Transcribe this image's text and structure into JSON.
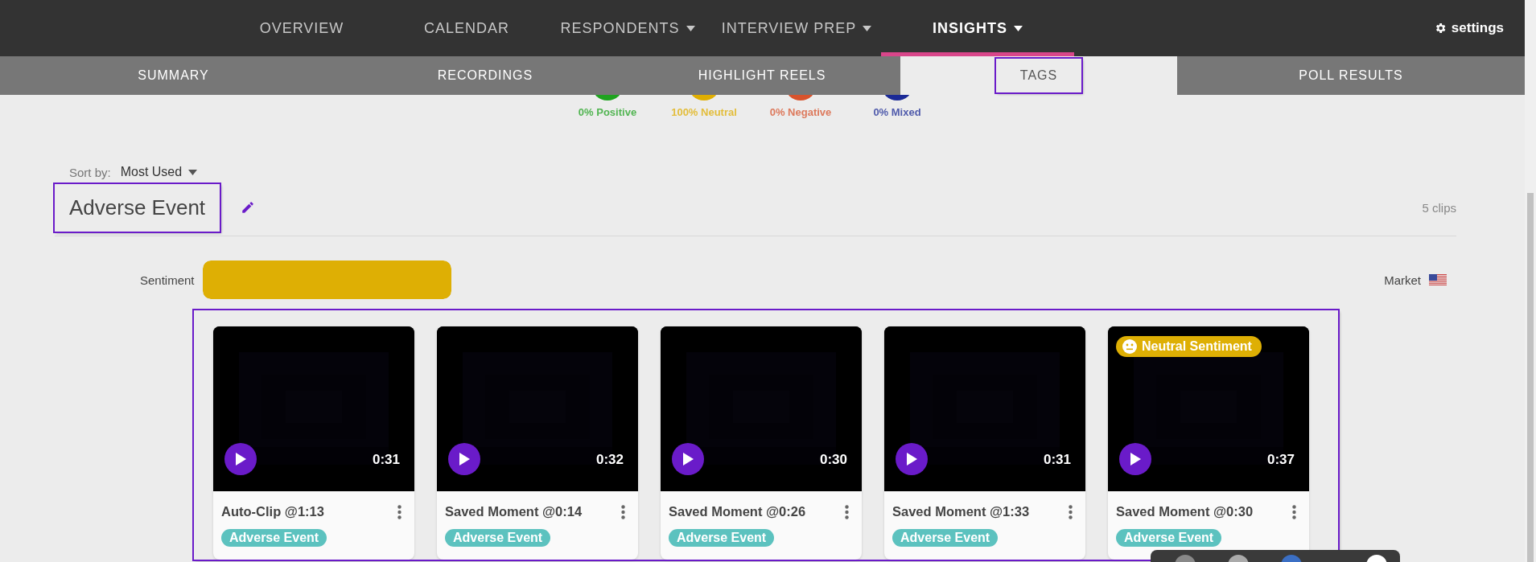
{
  "nav": {
    "items": [
      {
        "label": "OVERVIEW",
        "dropdown": false,
        "selected": false
      },
      {
        "label": "CALENDAR",
        "dropdown": false,
        "selected": false
      },
      {
        "label": "RESPONDENTS",
        "dropdown": true,
        "selected": false
      },
      {
        "label": "INTERVIEW PREP",
        "dropdown": true,
        "selected": false
      },
      {
        "label": "INSIGHTS",
        "dropdown": true,
        "selected": true
      }
    ],
    "settings": "settings"
  },
  "subnav": [
    {
      "label": "SUMMARY",
      "selected": false
    },
    {
      "label": "RECORDINGS",
      "selected": false
    },
    {
      "label": "HIGHLIGHT REELS",
      "selected": false
    },
    {
      "label": "TAGS",
      "selected": true
    },
    {
      "label": "POLL RESULTS",
      "selected": false
    }
  ],
  "sentiments": [
    {
      "label": "0% Positive",
      "color": "#1fa31f"
    },
    {
      "label": "100% Neutral",
      "color": "#e0ae00"
    },
    {
      "label": "0% Negative",
      "color": "#d8532c"
    },
    {
      "label": "0% Mixed",
      "color": "#1b2a96"
    }
  ],
  "sort": {
    "label": "Sort by:",
    "value": "Most Used"
  },
  "tag": {
    "title": "Adverse Event",
    "count": "5 clips",
    "sentiment_label": "Sentiment",
    "sentiment_bar": {
      "level": 1
    },
    "market_label": "Market"
  },
  "clips": [
    {
      "title": "Auto-Clip @1:13",
      "duration": "0:31",
      "tag": "Adverse Event"
    },
    {
      "title": "Saved Moment @0:14",
      "duration": "0:32",
      "tag": "Adverse Event"
    },
    {
      "title": "Saved Moment @0:26",
      "duration": "0:30",
      "tag": "Adverse Event"
    },
    {
      "title": "Saved Moment @1:33",
      "duration": "0:31",
      "tag": "Adverse Event"
    },
    {
      "title": "Saved Moment @0:30",
      "duration": "0:37",
      "tag": "Adverse Event",
      "badge": "Neutral Sentiment"
    }
  ]
}
